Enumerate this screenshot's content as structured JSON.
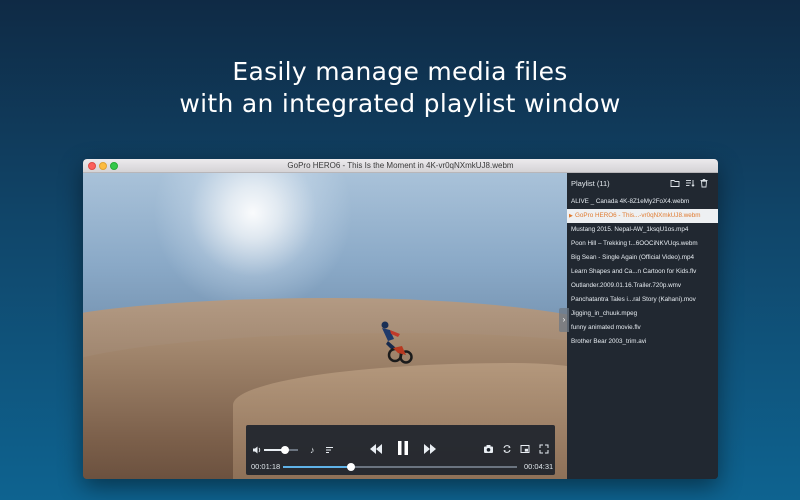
{
  "headline": {
    "line1": "Easily manage media files",
    "line2": "with an integrated playlist window"
  },
  "window": {
    "title": "GoPro HERO6 - This Is the Moment in 4K-vr0qNXmkUJ8.webm"
  },
  "player": {
    "current_time": "00:01:18",
    "remaining_time": "00:04:31",
    "playback_progress": 0.29,
    "volume_level": 0.62,
    "icons": {
      "volume": "speaker-icon",
      "audio_track": "music-note-icon",
      "subtitles": "subtitles-icon",
      "rewind": "rewind-icon",
      "pause": "pause-icon",
      "forward": "fast-forward-icon",
      "snapshot": "camera-icon",
      "loop": "repeat-icon",
      "pip": "picture-in-picture-icon",
      "fullscreen": "fullscreen-icon"
    }
  },
  "playlist": {
    "title": "Playlist (11)",
    "icons": [
      "folder-icon",
      "sort-icon",
      "trash-icon"
    ],
    "collapse_glyph": "›",
    "active_index": 1,
    "items": [
      "ALIVE _ Canada 4K-8Z1eMy2FoX4.webm",
      "GoPro HERO6 - This...-vr0qNXmkUJ8.webm",
      "Mustang 2015. Nepal-AW_1ksqU1os.mp4",
      "Poon Hill – Trekking t...6OOCiNKVUqs.webm",
      "Big Sean - Single Again (Official Video).mp4",
      "Learn Shapes and Ca...n Cartoon for Kids.flv",
      "Outlander.2009.01.16.Trailer.720p.wmv",
      "Panchatantra Tales i...ral Story (Kahani).mov",
      "Jigging_in_chuuk.mpeg",
      "funny animated movie.flv",
      "Brother Bear 2003_trim.avi"
    ]
  },
  "colors": {
    "accent_active": "#e07a2f",
    "seek_fill": "#5fb2e8"
  }
}
